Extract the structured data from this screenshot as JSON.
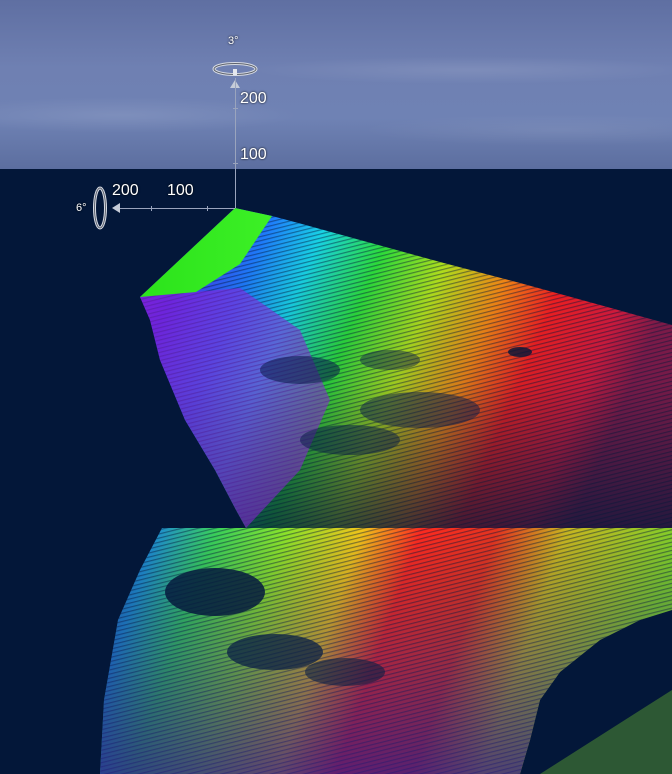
{
  "view": {
    "sky_color": "#6f80b2",
    "water_color": "#031739"
  },
  "gizmo": {
    "heading_angle": "3°",
    "tilt_angle": "6°",
    "vertical_scale": {
      "label_200": "200",
      "label_100": "100"
    },
    "horizontal_scale": {
      "label_200": "200",
      "label_100": "100"
    }
  },
  "colormap": {
    "shallow": "#ff1a1a",
    "mid": "#26e61a",
    "deep": "#9b1ee6"
  }
}
